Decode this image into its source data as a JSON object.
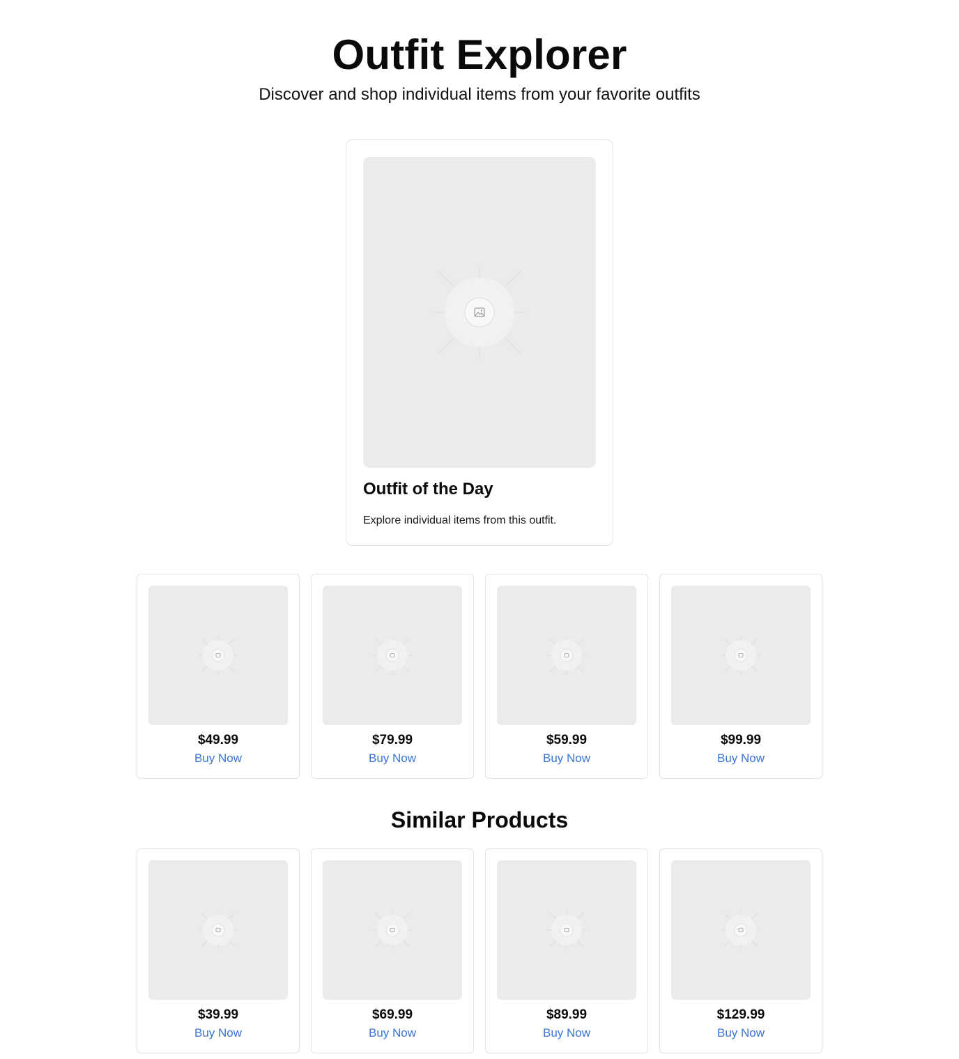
{
  "header": {
    "title": "Outfit Explorer",
    "subtitle": "Discover and shop individual items from your favorite outfits"
  },
  "feature": {
    "image_icon": "image-placeholder-icon",
    "title": "Outfit of the Day",
    "description": "Explore individual items from this outfit."
  },
  "outfit_items": [
    {
      "price": "$49.99",
      "cta": "Buy Now"
    },
    {
      "price": "$79.99",
      "cta": "Buy Now"
    },
    {
      "price": "$59.99",
      "cta": "Buy Now"
    },
    {
      "price": "$99.99",
      "cta": "Buy Now"
    }
  ],
  "similar": {
    "heading": "Similar Products",
    "items": [
      {
        "price": "$39.99",
        "cta": "Buy Now"
      },
      {
        "price": "$69.99",
        "cta": "Buy Now"
      },
      {
        "price": "$89.99",
        "cta": "Buy Now"
      },
      {
        "price": "$129.99",
        "cta": "Buy Now"
      }
    ]
  },
  "colors": {
    "link": "#3a74d4",
    "placeholder_bg": "#ebebeb",
    "card_border": "#e4e4e4"
  }
}
